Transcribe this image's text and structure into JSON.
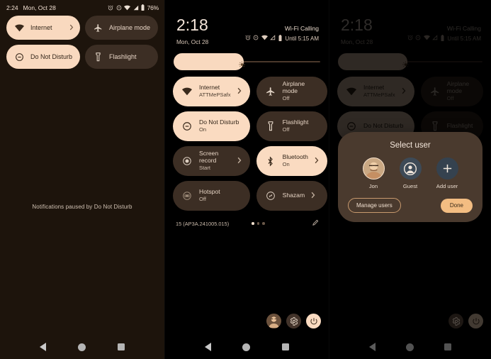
{
  "panel1": {
    "statusbar": {
      "time": "2:24",
      "date": "Mon, Oct 28",
      "battery_pct": "76%",
      "icons": [
        "alarm-icon",
        "dnd-icon",
        "wifi-icon",
        "signal-icon",
        "battery-icon"
      ]
    },
    "tiles": [
      {
        "label": "Internet",
        "sub": "",
        "icon": "wifi-icon",
        "state": "on",
        "chevron": true
      },
      {
        "label": "Airplane mode",
        "sub": "",
        "icon": "airplane-icon",
        "state": "off",
        "chevron": false
      },
      {
        "label": "Do Not Disturb",
        "sub": "",
        "icon": "dnd-icon",
        "state": "on",
        "chevron": false
      },
      {
        "label": "Flashlight",
        "sub": "",
        "icon": "flashlight-icon",
        "state": "off",
        "chevron": false
      }
    ],
    "notification_text": "Notifications paused by Do Not Disturb"
  },
  "panel2": {
    "statusbar": {
      "time": "2:18",
      "date": "Mon, Oct 28",
      "carrier": "Wi-Fi Calling",
      "until": "Until 5:15 AM",
      "icons": [
        "alarm-icon",
        "dnd-icon",
        "wifi-icon",
        "signal-icon",
        "battery-icon"
      ]
    },
    "brightness": {
      "icon": "brightness-icon",
      "value_pct": 48
    },
    "tiles": [
      {
        "label": "Internet",
        "sub": "ATTMePSafx",
        "icon": "wifi-icon",
        "state": "on",
        "chevron": true
      },
      {
        "label": "Airplane mode",
        "sub": "Off",
        "icon": "airplane-icon",
        "state": "off",
        "chevron": false
      },
      {
        "label": "Do Not Disturb",
        "sub": "On",
        "icon": "dnd-icon",
        "state": "on",
        "chevron": false
      },
      {
        "label": "Flashlight",
        "sub": "Off",
        "icon": "flashlight-icon",
        "state": "off",
        "chevron": false
      },
      {
        "label": "Screen record",
        "sub": "Start",
        "icon": "screen-record-icon",
        "state": "off",
        "chevron": true
      },
      {
        "label": "Bluetooth",
        "sub": "On",
        "icon": "bluetooth-icon",
        "state": "on",
        "chevron": true
      },
      {
        "label": "Hotspot",
        "sub": "Off",
        "icon": "hotspot-icon",
        "state": "off",
        "chevron": false
      },
      {
        "label": "Shazam",
        "sub": "",
        "icon": "shazam-icon",
        "state": "off",
        "chevron": true
      }
    ],
    "footer": {
      "build": "15 (AP3A.241005.015)",
      "page_dots": 3,
      "active_dot": 1,
      "edit_icon": "pencil-icon"
    },
    "bottom_icons": [
      "avatar-icon",
      "gear-icon",
      "power-icon"
    ]
  },
  "panel3": {
    "statusbar": {
      "time": "2:18",
      "date": "Mon, Oct 28",
      "carrier": "Wi-Fi Calling",
      "until": "Until 5:15 AM"
    },
    "brightness": {
      "icon": "brightness-icon",
      "value_pct": 48
    },
    "tiles": [
      {
        "label": "Internet",
        "sub": "ATTMePSafx",
        "icon": "wifi-icon",
        "state": "on",
        "chevron": true
      },
      {
        "label": "Airplane mode",
        "sub": "Off",
        "icon": "airplane-icon",
        "state": "off",
        "chevron": false
      },
      {
        "label": "Do Not Disturb",
        "sub": "",
        "icon": "dnd-icon",
        "state": "on",
        "chevron": false
      },
      {
        "label": "Flashlight",
        "sub": "",
        "icon": "flashlight-icon",
        "state": "off",
        "chevron": false
      }
    ],
    "dialog": {
      "title": "Select user",
      "users": [
        {
          "name": "Jon",
          "avatar": "photo-avatar-icon"
        },
        {
          "name": "Guest",
          "avatar": "guest-account-icon"
        },
        {
          "name": "Add user",
          "avatar": "plus-icon"
        }
      ],
      "manage_label": "Manage users",
      "done_label": "Done"
    },
    "bottom_icons": [
      "gear-icon",
      "power-icon"
    ]
  },
  "navbar": {
    "back": "back-icon",
    "home": "home-icon",
    "recents": "recents-icon"
  },
  "colors": {
    "tile_on": "#f9d9bf",
    "tile_off": "#3c2e24",
    "sheet_bg": "#1d140c",
    "dialog_bg": "#4a3a2e",
    "accent": "#f3bd82"
  }
}
